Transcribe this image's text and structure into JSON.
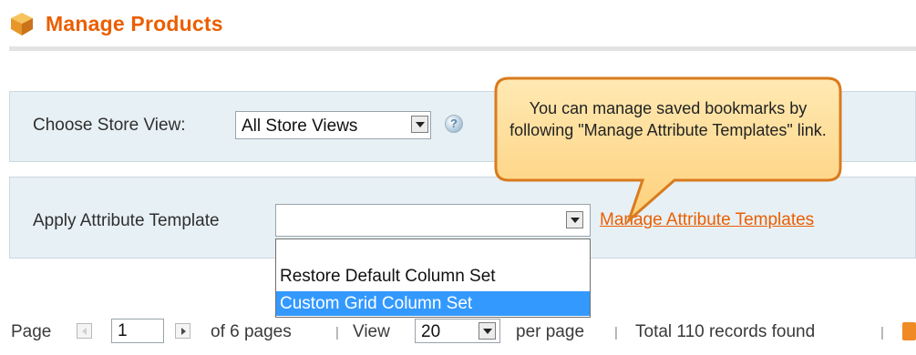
{
  "header": {
    "title": "Manage Products",
    "icon": "cube-icon"
  },
  "store_view": {
    "label": "Choose Store View:",
    "selected": "All Store Views",
    "help_icon": "help-icon"
  },
  "attribute_template": {
    "label": "Apply Attribute Template",
    "selected": "",
    "manage_link": "Manage Attribute Templates",
    "options": [
      "Restore Default Column Set",
      "Custom Grid Column Set"
    ],
    "highlighted_option": "Custom Grid Column Set"
  },
  "callout": {
    "text": "You can manage saved bookmarks by following \"Manage Attribute Templates\" link."
  },
  "pager": {
    "page_label": "Page",
    "current_page": "1",
    "of_pages": "of 6 pages",
    "view_label": "View",
    "per_page_value": "20",
    "per_page_label": "per page",
    "total_text": "Total 110 records found",
    "separator": "|"
  },
  "colors": {
    "accent": "#eb5e00",
    "panel_bg": "#e7f0f5",
    "highlight": "#3399ff"
  }
}
